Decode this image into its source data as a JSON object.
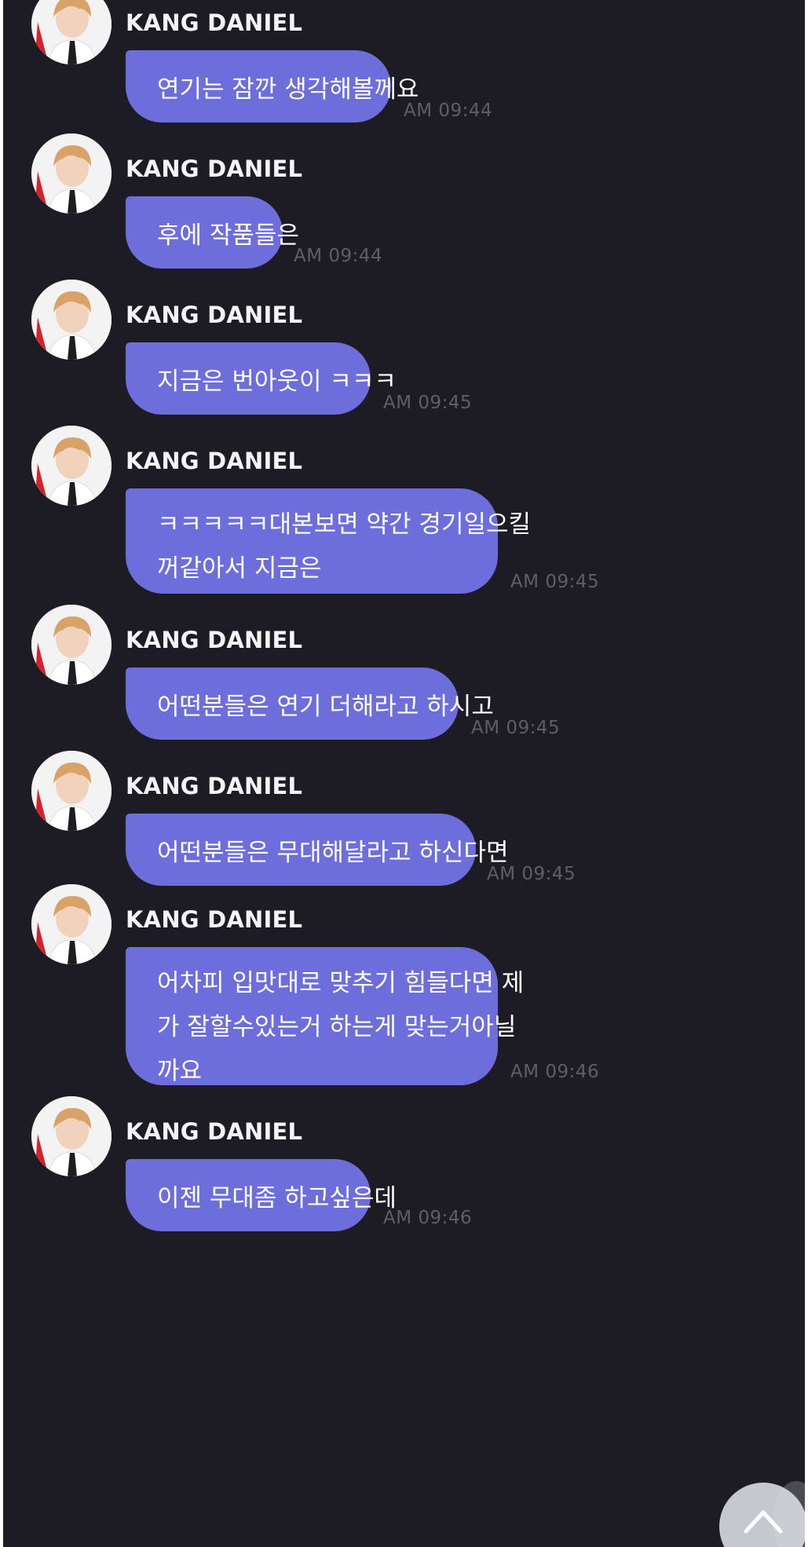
{
  "colors": {
    "background": "#1d1c24",
    "bubble": "#6d6edc",
    "bubble_text": "#ffffff",
    "sender_text": "#f4f4f6",
    "timestamp_text": "#5e5e68"
  },
  "messages": [
    {
      "sender": "KANG DANIEL",
      "lines": [
        "연기는 잠깐 생각해볼께요"
      ],
      "time": "AM 09:44"
    },
    {
      "sender": "KANG DANIEL",
      "lines": [
        "후에 작품들은"
      ],
      "time": "AM 09:44"
    },
    {
      "sender": "KANG DANIEL",
      "lines": [
        "지금은 번아웃이 ㅋㅋㅋ"
      ],
      "time": "AM 09:45"
    },
    {
      "sender": "KANG DANIEL",
      "lines": [
        "ㅋㅋㅋㅋㅋ대본보면 약간 경기일으킬",
        "꺼같아서 지금은"
      ],
      "time": "AM 09:45"
    },
    {
      "sender": "KANG DANIEL",
      "lines": [
        "어떤분들은 연기 더해라고 하시고"
      ],
      "time": "AM 09:45"
    },
    {
      "sender": "KANG DANIEL",
      "lines": [
        "어떤분들은 무대해달라고 하신다면"
      ],
      "time": "AM 09:45"
    },
    {
      "sender": "KANG DANIEL",
      "lines": [
        "어차피 입맛대로 맞추기 힘들다면 제",
        "가 잘할수있는거 하는게 맞는거아닐",
        "까요"
      ],
      "time": "AM 09:46"
    },
    {
      "sender": "KANG DANIEL",
      "lines": [
        "이젠 무대좀 하고싶은데"
      ],
      "time": "AM 09:46"
    }
  ],
  "icons": {
    "avatar": "profile-photo",
    "scroll_top": "chevron-up-icon"
  }
}
